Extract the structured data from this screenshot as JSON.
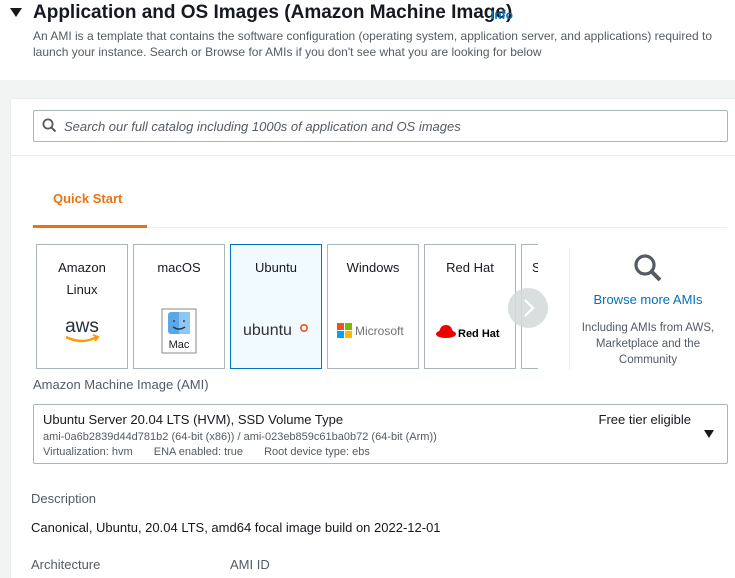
{
  "section": {
    "title": "Application and OS Images (Amazon Machine Image)",
    "info": "Info",
    "description": "An AMI is a template that contains the software configuration (operating system, application server, and applications) required to launch your instance. Search or Browse for AMIs if you don't see what you are looking for below"
  },
  "search": {
    "placeholder": "Search our full catalog including 1000s of application and OS images"
  },
  "tabs": [
    {
      "label": "Quick Start",
      "active": true
    }
  ],
  "quick_start": {
    "cards": [
      {
        "label": "Amazon\nLinux",
        "logo": "aws"
      },
      {
        "label": "macOS",
        "logo": "Mac"
      },
      {
        "label": "Ubuntu",
        "logo": "ubuntu",
        "selected": true
      },
      {
        "label": "Windows",
        "logo": "Microsoft"
      },
      {
        "label": "Red Hat",
        "logo": "Red Hat"
      },
      {
        "label": "S"
      }
    ],
    "browse": {
      "link": "Browse more AMIs",
      "description": "Including AMIs from AWS, Marketplace and the Community"
    }
  },
  "ami": {
    "label": "Amazon Machine Image (AMI)",
    "name": "Ubuntu Server 20.04 LTS (HVM), SSD Volume Type",
    "badge": "Free tier eligible",
    "ids": "ami-0a6b2839d44d781b2 (64-bit (x86)) / ami-023eb859c61ba0b72 (64-bit (Arm))",
    "virtualization": "Virtualization: hvm",
    "ena": "ENA enabled: true",
    "root_device": "Root device type: ebs"
  },
  "details": {
    "description_label": "Description",
    "description_value": "Canonical, Ubuntu, 20.04 LTS, amd64 focal image build on 2022-12-01",
    "architecture_label": "Architecture",
    "ami_id_label": "AMI ID"
  },
  "colors": {
    "accent": "#ec7211",
    "link": "#0073bb",
    "selected_bg": "#f1faff"
  }
}
